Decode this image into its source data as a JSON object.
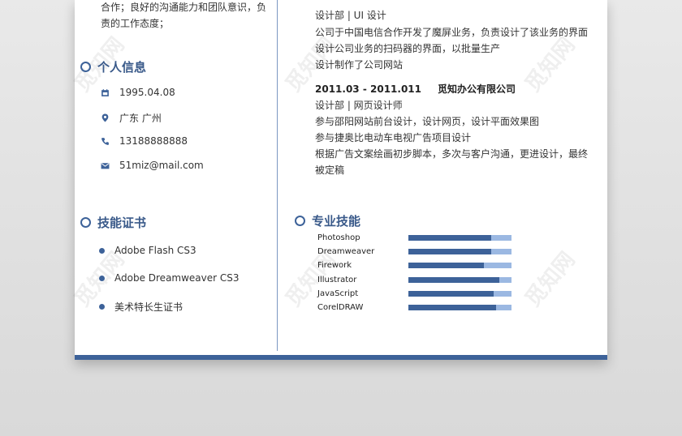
{
  "intro": {
    "lines": [
      "合作；良好的沟通能力和团队意识，负",
      "责的工作态度；"
    ]
  },
  "personal": {
    "title": "个人信息",
    "birth": "1995.04.08",
    "location": "广东  广州",
    "phone": "13188888888",
    "email": "51miz@mail.com"
  },
  "certs": {
    "title": "技能证书",
    "items": [
      "Adobe Flash CS3",
      "Adobe Dreamweaver CS3",
      "美术特长生证书"
    ]
  },
  "experience": {
    "entry1": {
      "dept": "设计部 | UI 设计",
      "lines": [
        "公司于中国电信合作开发了魔屏业务，负责设计了该业务的界面",
        "设计公司业务的扫码器的界面，以批量生产",
        "设计制作了公司网站"
      ]
    },
    "entry2": {
      "period": "2011.03 - 2011.011",
      "company": "觅知办公有限公司",
      "dept": "设计部 | 网页设计师",
      "lines": [
        "参与邵阳网站前台设计，设计网页，设计平面效果图",
        "参与捷奥比电动车电视广告项目设计",
        "根据广告文案绘画初步脚本，多次与客户沟通，更进设计，最终",
        "被定稿"
      ]
    }
  },
  "skills": {
    "title": "专业技能",
    "items": [
      {
        "name": "Photoshop",
        "level": 0.8
      },
      {
        "name": "Dreamweaver",
        "level": 0.8
      },
      {
        "name": "Firework",
        "level": 0.73
      },
      {
        "name": "Illustrator",
        "level": 0.88
      },
      {
        "name": "JavaScript",
        "level": 0.83
      },
      {
        "name": "CorelDRAW",
        "level": 0.85
      }
    ]
  },
  "watermark": "觅知网",
  "colors": {
    "accent": "#3d6299",
    "bar_light": "#9bb8e2",
    "title": "#3a5a8a"
  }
}
